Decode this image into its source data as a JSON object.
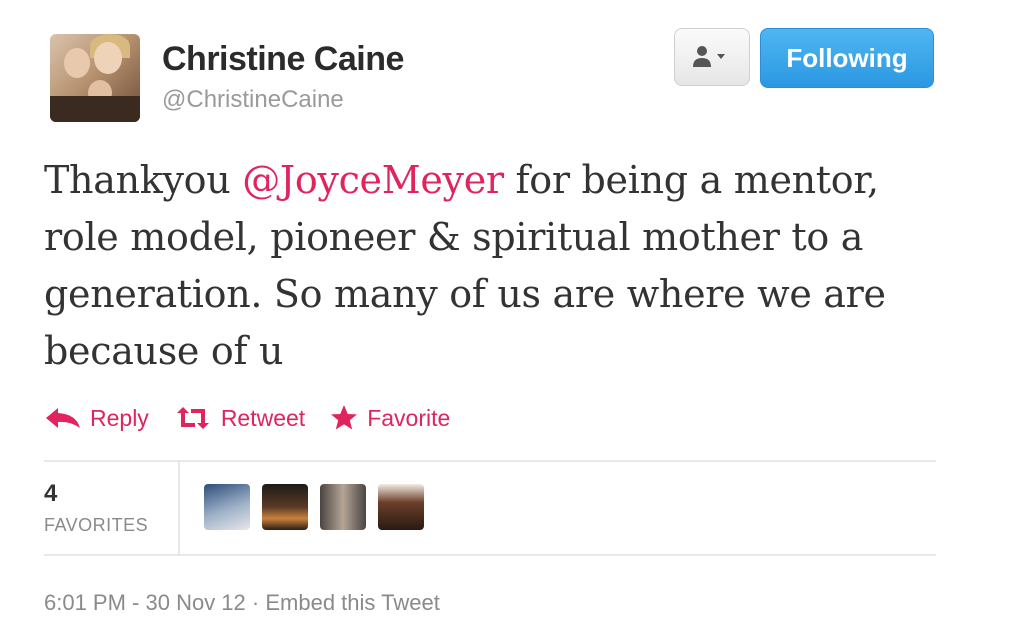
{
  "user": {
    "display_name": "Christine Caine",
    "handle": "@ChristineCaine"
  },
  "buttons": {
    "following_label": "Following"
  },
  "tweet": {
    "text_before": "Thankyou ",
    "mention": "@JoyceMeyer",
    "text_after": " for being a mentor, role model, pioneer & spiritual mother to a generation. So many of us are where we are because of u"
  },
  "actions": {
    "reply_label": "Reply",
    "retweet_label": "Retweet",
    "favorite_label": "Favorite"
  },
  "stats": {
    "favorites_count": "4",
    "favorites_label": "FAVORITES"
  },
  "footer": {
    "timestamp": "6:01 PM - 30 Nov 12",
    "separator": " · ",
    "embed_label": "Embed this Tweet"
  },
  "colors": {
    "accent": "#e0245e",
    "following_blue": "#2a98e2"
  },
  "icons": [
    "user-dropdown-icon",
    "reply-icon",
    "retweet-icon",
    "favorite-icon"
  ]
}
